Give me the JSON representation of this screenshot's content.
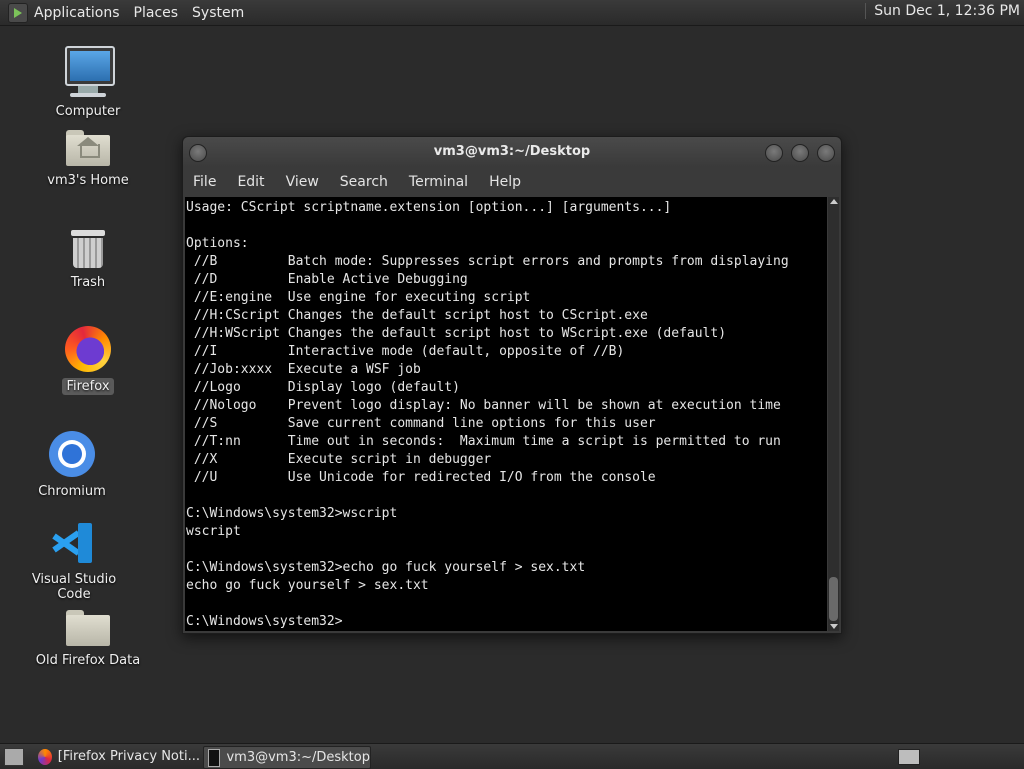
{
  "top_panel": {
    "menu": [
      "Applications",
      "Places",
      "System"
    ],
    "clock": "Sun Dec  1, 12:36 PM"
  },
  "desktop_icons": [
    {
      "label": "Computer",
      "icon": "computer-icon"
    },
    {
      "label": "vm3's Home",
      "icon": "home-folder-icon"
    },
    {
      "label": "Trash",
      "icon": "trash-icon"
    },
    {
      "label": "Firefox",
      "icon": "firefox-icon",
      "selected": true
    },
    {
      "label": "Chromium",
      "icon": "chromium-icon"
    },
    {
      "label": "Visual Studio Code",
      "icon": "vscode-icon"
    },
    {
      "label": "Old Firefox Data",
      "icon": "folder-icon"
    }
  ],
  "terminal": {
    "title": "vm3@vm3:~/Desktop",
    "menu": [
      "File",
      "Edit",
      "View",
      "Search",
      "Terminal",
      "Help"
    ],
    "lines": [
      "Usage: CScript scriptname.extension [option...] [arguments...]",
      "",
      "Options:",
      " //B         Batch mode: Suppresses script errors and prompts from displaying",
      " //D         Enable Active Debugging",
      " //E:engine  Use engine for executing script",
      " //H:CScript Changes the default script host to CScript.exe",
      " //H:WScript Changes the default script host to WScript.exe (default)",
      " //I         Interactive mode (default, opposite of //B)",
      " //Job:xxxx  Execute a WSF job",
      " //Logo      Display logo (default)",
      " //Nologo    Prevent logo display: No banner will be shown at execution time",
      " //S         Save current command line options for this user",
      " //T:nn      Time out in seconds:  Maximum time a script is permitted to run",
      " //X         Execute script in debugger",
      " //U         Use Unicode for redirected I/O from the console",
      "",
      "C:\\Windows\\system32>wscript",
      "wscript",
      "",
      "C:\\Windows\\system32>echo go fuck yourself > sex.txt",
      "echo go fuck yourself > sex.txt",
      "",
      "C:\\Windows\\system32>"
    ]
  },
  "taskbar": {
    "tasks": [
      {
        "label": "[Firefox Privacy Noti...",
        "icon": "firefox-icon",
        "active": false
      },
      {
        "label": "vm3@vm3:~/Desktop",
        "icon": "terminal-icon",
        "active": true
      }
    ]
  }
}
